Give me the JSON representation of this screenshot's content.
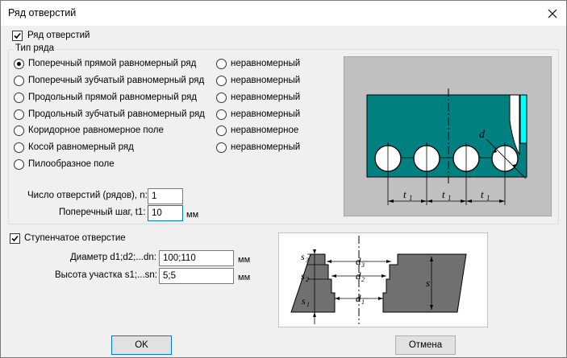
{
  "window": {
    "title": "Ряд отверстий"
  },
  "row_checkbox": {
    "label": "Ряд отверстий",
    "checked": true
  },
  "row_type": {
    "legend": "Тип ряда",
    "uniform": [
      {
        "label": "Поперечный прямой равномерный ряд",
        "selected": true
      },
      {
        "label": "Поперечный зубчатый равномерный ряд",
        "selected": false
      },
      {
        "label": "Продольный прямой равномерный ряд",
        "selected": false
      },
      {
        "label": "Продольный зубчатый равномерный ряд",
        "selected": false
      },
      {
        "label": "Коридорное равномерное поле",
        "selected": false
      },
      {
        "label": "Косой равномерный ряд",
        "selected": false
      },
      {
        "label": "Пилообразное поле",
        "selected": false
      }
    ],
    "nonuniform": [
      {
        "label": "неравномерный"
      },
      {
        "label": "неравномерный"
      },
      {
        "label": "неравномерный"
      },
      {
        "label": "неравномерный"
      },
      {
        "label": "неравномерное"
      },
      {
        "label": "неравномерный"
      }
    ]
  },
  "count": {
    "label": "Число отверстий (рядов), n:",
    "value": "1"
  },
  "pitch": {
    "label": "Поперечный шаг, t1:",
    "value": "10",
    "unit": "мм"
  },
  "stepped": {
    "label": "Ступенчатое отверстие",
    "checked": true,
    "diameter": {
      "label": "Диаметр d1;d2;...dn:",
      "value": "100;110",
      "unit": "мм"
    },
    "height": {
      "label": "Высота участка s1;...sn:",
      "value": "5;5",
      "unit": "мм"
    }
  },
  "buttons": {
    "ok": "OK",
    "cancel": "Отмена"
  },
  "diagram1": {
    "d": "d",
    "t": "t",
    "sub": "1"
  },
  "diagram2": {
    "s3": "s",
    "s3sub": "3",
    "s2": "s",
    "s2sub": "2",
    "s1": "s",
    "s1sub": "1",
    "d3": "d",
    "d3sub": "3",
    "d2": "d",
    "d2sub": "2",
    "d1": "d",
    "d1sub": "1",
    "s": "s"
  },
  "colors": {
    "plate": "#008080",
    "cyan": "#00ffff",
    "accent": "#0078d7",
    "steel": "#707070"
  }
}
